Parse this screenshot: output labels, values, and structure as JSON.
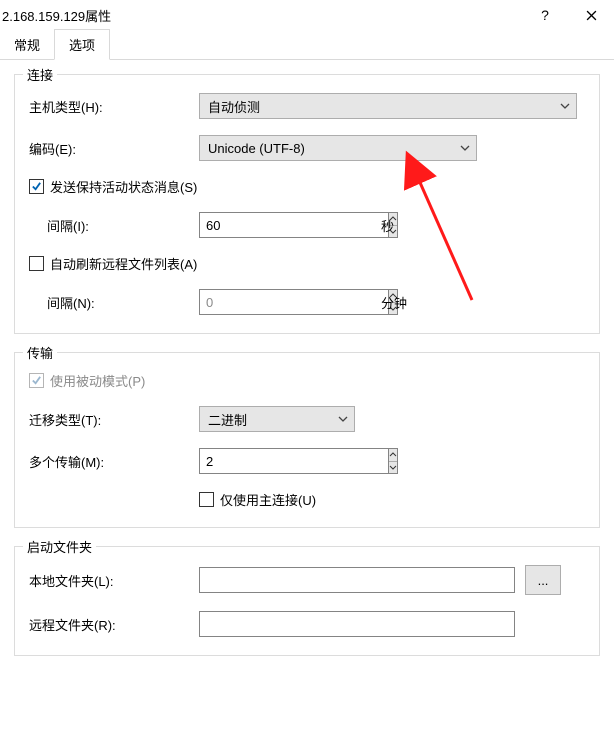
{
  "window": {
    "title": "2.168.159.129属性",
    "help_symbol": "?",
    "close_symbol": "×"
  },
  "tabs": {
    "general": "常规",
    "options": "选项"
  },
  "connection": {
    "legend": "连接",
    "host_type_label": "主机类型(H):",
    "host_type_value": "自动侦测",
    "encoding_label": "编码(E):",
    "encoding_value": "Unicode (UTF-8)",
    "keepalive_label": "发送保持活动状态消息(S)",
    "keepalive_checked": true,
    "keepalive_interval_label": "间隔(I):",
    "keepalive_interval_value": "60",
    "keepalive_interval_unit": "秒",
    "autorefresh_label": "自动刷新远程文件列表(A)",
    "autorefresh_checked": false,
    "autorefresh_interval_label": "间隔(N):",
    "autorefresh_interval_value": "0",
    "autorefresh_interval_unit": "分钟"
  },
  "transfer": {
    "legend": "传输",
    "passive_label": "使用被动模式(P)",
    "passive_checked": true,
    "migrate_label": "迁移类型(T):",
    "migrate_value": "二进制",
    "multi_label": "多个传输(M):",
    "multi_value": "2",
    "only_main_label": "仅使用主连接(U)",
    "only_main_checked": false
  },
  "startup": {
    "legend": "启动文件夹",
    "local_label": "本地文件夹(L):",
    "local_value": "",
    "browse_label": "...",
    "remote_label": "远程文件夹(R):",
    "remote_value": ""
  }
}
